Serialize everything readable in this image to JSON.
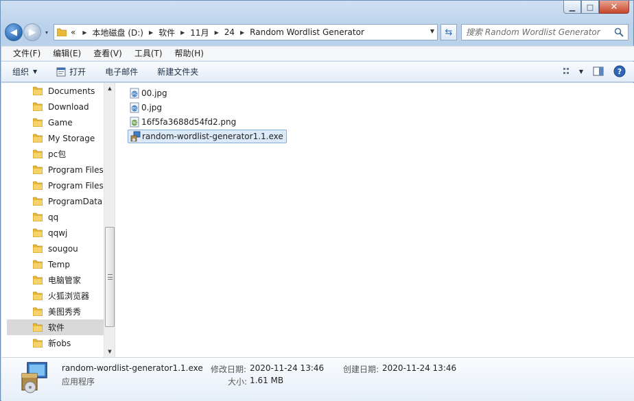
{
  "window": {
    "min_glyph": "▁",
    "max_glyph": "□",
    "close_glyph": "✕"
  },
  "nav": {
    "back_glyph": "◀",
    "forward_glyph": "▶",
    "history_glyph": "▾"
  },
  "address": {
    "overflow": "«",
    "crumbs": [
      "本地磁盘 (D:)",
      "软件",
      "11月",
      "24",
      "Random Wordlist Generator"
    ],
    "sep_glyph": "▶",
    "dropdown_glyph": "▼",
    "refresh_glyph": "⇆"
  },
  "search": {
    "placeholder": "搜索 Random Wordlist Generator"
  },
  "menu": {
    "items": [
      "文件(F)",
      "编辑(E)",
      "查看(V)",
      "工具(T)",
      "帮助(H)"
    ]
  },
  "commands": {
    "organize": "组织",
    "open": "打开",
    "email": "电子邮件",
    "new_folder": "新建文件夹",
    "caret": "▼"
  },
  "navpane": {
    "items": [
      {
        "label": "Documents"
      },
      {
        "label": "Download"
      },
      {
        "label": "Game"
      },
      {
        "label": "My Storage"
      },
      {
        "label": "pc包"
      },
      {
        "label": "Program Files"
      },
      {
        "label": "Program Files"
      },
      {
        "label": "ProgramData"
      },
      {
        "label": "qq"
      },
      {
        "label": "qqwj"
      },
      {
        "label": "sougou"
      },
      {
        "label": "Temp"
      },
      {
        "label": "电脑管家"
      },
      {
        "label": "火狐浏览器"
      },
      {
        "label": "美图秀秀"
      },
      {
        "label": "软件",
        "selected": true
      },
      {
        "label": "新obs"
      }
    ],
    "scroll_up": "▲",
    "scroll_down": "▼"
  },
  "files": [
    {
      "name": "00.jpg",
      "type": "jpg"
    },
    {
      "name": "0.jpg",
      "type": "jpg"
    },
    {
      "name": "16f5fa3688d54fd2.png",
      "type": "png"
    },
    {
      "name": "random-wordlist-generator1.1.exe",
      "type": "exe",
      "selected": true
    }
  ],
  "details": {
    "name": "random-wordlist-generator1.1.exe",
    "type": "应用程序",
    "modified_label": "修改日期:",
    "modified_value": "2020-11-24 13:46",
    "created_label": "创建日期:",
    "created_value": "2020-11-24 13:46",
    "size_label": "大小:",
    "size_value": "1.61 MB"
  },
  "colors": {
    "folder": "#e8b93a",
    "selection": "#dce9f8",
    "selection_border": "#84acdd",
    "accent": "#2c6cb5"
  }
}
